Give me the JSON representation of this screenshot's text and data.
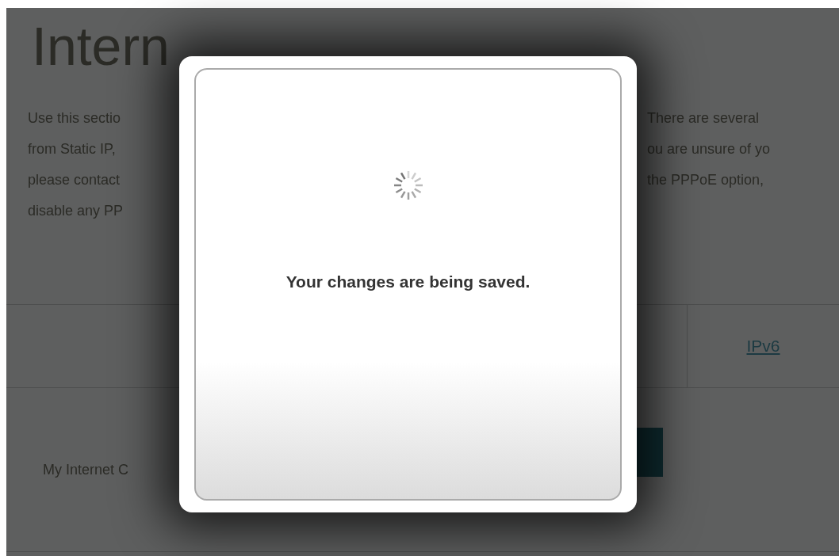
{
  "page": {
    "title": "Intern",
    "description_left": [
      "Use this sectio",
      "from Static IP,",
      "please contact",
      "disable any PP"
    ],
    "description_right": [
      "There are several",
      "ou are unsure of yo",
      "the PPPoE option,"
    ],
    "tabs": [
      {
        "label": "IPv6",
        "selected": false
      }
    ],
    "connection_label": "My Internet C"
  },
  "dialog": {
    "message": "Your changes are being saved."
  }
}
